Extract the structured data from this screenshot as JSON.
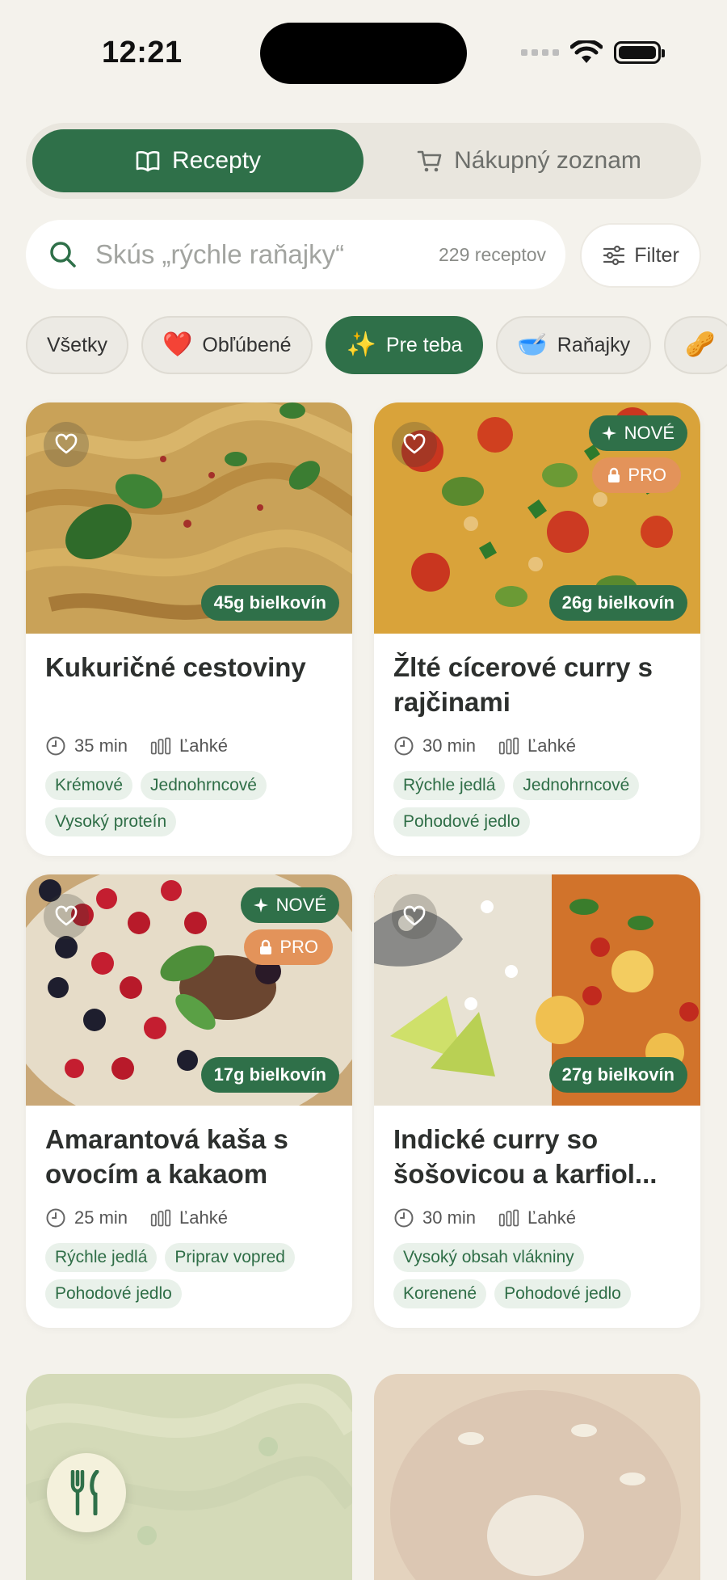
{
  "status": {
    "time": "12:21"
  },
  "tabs": {
    "recipes_label": "Recepty",
    "shopping_label": "Nákupný zoznam"
  },
  "search": {
    "placeholder": "Skús „rýchle raňajky“",
    "count": "229 receptov"
  },
  "filter_label": "Filter",
  "chips": [
    {
      "label": "Všetky",
      "emoji": ""
    },
    {
      "label": "Obľúbené",
      "emoji": "❤️"
    },
    {
      "label": "Pre teba",
      "emoji": "✨"
    },
    {
      "label": "Raňajky",
      "emoji": "🥣"
    },
    {
      "label": "",
      "emoji": "🥜"
    }
  ],
  "badges": {
    "new": "NOVÉ",
    "pro": "PRO"
  },
  "recipes": [
    {
      "title": "Kukuričné cestoviny",
      "protein": "45g bielkovín",
      "time": "35 min",
      "difficulty": "Ľahké",
      "tags": [
        "Krémové",
        "Jednohrncové",
        "Vysoký proteín"
      ]
    },
    {
      "title": "Žlté cícerové curry s rajčinami",
      "protein": "26g bielkovín",
      "time": "30 min",
      "difficulty": "Ľahké",
      "tags": [
        "Rýchle jedlá",
        "Jednohrncové",
        "Pohodové jedlo"
      ]
    },
    {
      "title": "Amarantová kaša s ovocím a kakaom",
      "protein": "17g bielkovín",
      "time": "25 min",
      "difficulty": "Ľahké",
      "tags": [
        "Rýchle jedlá",
        "Priprav vopred",
        "Pohodové jedlo"
      ]
    },
    {
      "title": "Indické curry so šošovicou a karfiol...",
      "protein": "27g bielkovín",
      "time": "30 min",
      "difficulty": "Ľahké",
      "tags": [
        "Vysoký obsah vlákniny",
        "Korenené",
        "Pohodové jedlo"
      ]
    }
  ],
  "colors": {
    "accent": "#2f7049",
    "pro": "#e3935a",
    "background": "#f4f2ec"
  },
  "icons": {
    "fab": "fork-knife-icon"
  }
}
